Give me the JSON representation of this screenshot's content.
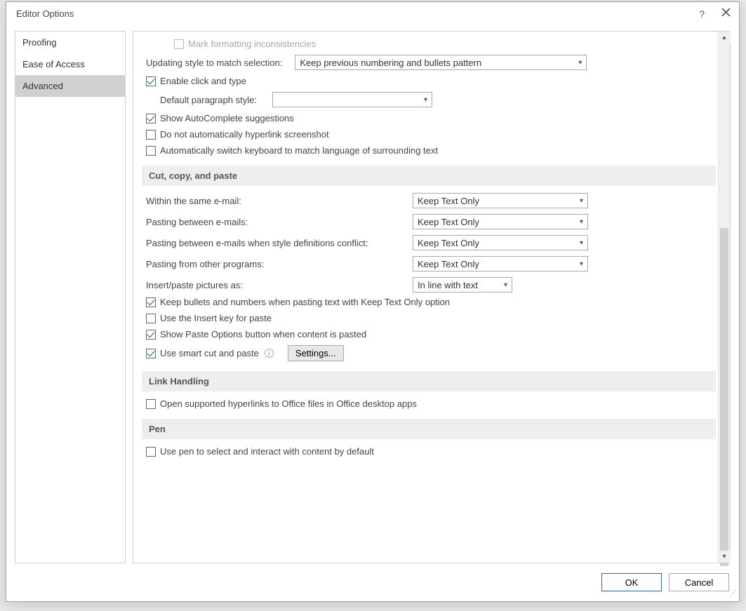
{
  "title": "Editor Options",
  "sidebar": {
    "items": [
      {
        "label": "Proofing"
      },
      {
        "label": "Ease of Access"
      },
      {
        "label": "Advanced"
      }
    ]
  },
  "editing": {
    "mark_formatting": "Mark formatting inconsistencies",
    "updating_style_label": "Updating style to match selection:",
    "updating_style_value": "Keep previous numbering and bullets pattern",
    "enable_click_type": "Enable click and type",
    "default_para_label": "Default paragraph style:",
    "default_para_value": "",
    "show_autocomplete": "Show AutoComplete suggestions",
    "no_auto_hyperlink": "Do not automatically hyperlink screenshot",
    "auto_switch_keyboard": "Automatically switch keyboard to match language of surrounding text"
  },
  "sections": {
    "cut_copy_paste": "Cut, copy, and paste",
    "link_handling": "Link Handling",
    "pen": "Pen"
  },
  "paste": {
    "within_same_label": "Within the same e-mail:",
    "within_same_value": "Keep Text Only",
    "between_label": "Pasting between e-mails:",
    "between_value": "Keep Text Only",
    "between_conflict_label": "Pasting between e-mails when style definitions conflict:",
    "between_conflict_value": "Keep Text Only",
    "other_programs_label": "Pasting from other programs:",
    "other_programs_value": "Keep Text Only",
    "insert_pictures_label": "Insert/paste pictures as:",
    "insert_pictures_value": "In line with text",
    "keep_bullets": "Keep bullets and numbers when pasting text with Keep Text Only option",
    "use_insert_key": "Use the Insert key for paste",
    "show_paste_options": "Show Paste Options button when content is pasted",
    "smart_cut_paste": "Use smart cut and paste",
    "settings_btn": "Settings..."
  },
  "link": {
    "open_supported": "Open supported hyperlinks to Office files in Office desktop apps"
  },
  "pen": {
    "use_pen": "Use pen to select and interact with content by default"
  },
  "footer": {
    "ok": "OK",
    "cancel": "Cancel"
  }
}
